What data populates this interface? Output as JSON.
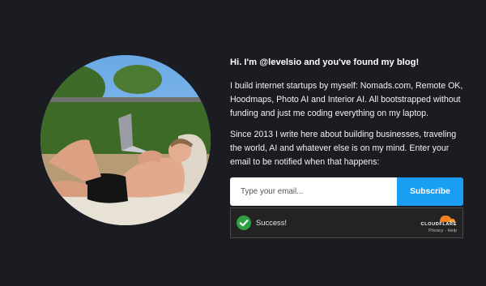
{
  "blog": {
    "headline": "Hi. I'm @levelsio and you've found my blog!",
    "paragraphs": [
      "I build internet startups by myself: Nomads.com, Remote OK, Hoodmaps, Photo AI and Interior AI. All bootstrapped without funding and just me coding everything on my laptop.",
      "Since 2013 I write here about building businesses, traveling the world, AI and whatever else is on my mind. Enter your email to be notified when that happens:"
    ]
  },
  "signup": {
    "email_placeholder": "Type your email...",
    "subscribe_label": "Subscribe"
  },
  "captcha": {
    "status_text": "Success!",
    "brand": "CLOUDFLARE",
    "privacy_link": "Privacy",
    "separator": "·",
    "help_link": "Help"
  },
  "colors": {
    "background": "#1b1c21",
    "accent": "#1a9ef3",
    "success": "#2ea043",
    "cloudflare_orange": "#f48120"
  },
  "icons": {
    "success": "checkmark-icon",
    "brand": "cloudflare-cloud-icon"
  }
}
